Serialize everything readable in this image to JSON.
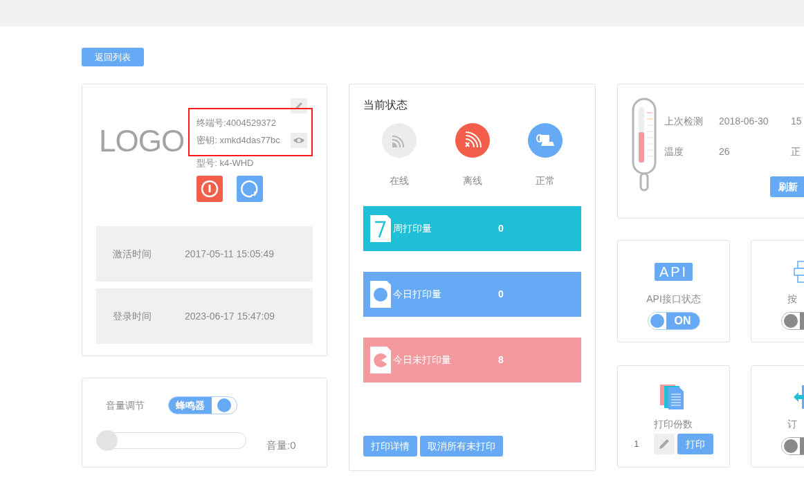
{
  "back_button": "返回列表",
  "device": {
    "logo": "LOGO",
    "terminal": "终端号:4004529372",
    "secret": "密钥: xmkd4das77bc",
    "model": "型号: k4-WHD",
    "times": [
      {
        "label": "激活时间",
        "value": "2017-05-11 15:05:49"
      },
      {
        "label": "登录时间",
        "value": "2023-06-17 15:47:09"
      }
    ]
  },
  "volume": {
    "label": "音量调节",
    "buzzer": {
      "label": "蜂鸣器",
      "on": true
    },
    "slider": {
      "level": 0
    },
    "reading": "音量:0"
  },
  "status": {
    "title": "当前状态",
    "indicators": [
      {
        "kind": "wifi",
        "label": "在线",
        "active": false
      },
      {
        "kind": "wifi-off",
        "label": "离线",
        "active": true
      },
      {
        "kind": "paper",
        "label": "正常",
        "active": true
      }
    ],
    "stats": [
      {
        "kind": "week",
        "label": "周打印量",
        "value": "0",
        "color": "#1fc0d7"
      },
      {
        "kind": "today",
        "label": "今日打印量",
        "value": "0",
        "color": "#66aaf6"
      },
      {
        "kind": "pending",
        "label": "今日未打印量",
        "value": "8",
        "color": "#f4999e"
      }
    ],
    "buttons": [
      "打印详情",
      "取消所有未打印"
    ]
  },
  "sensor": {
    "thermometer": {
      "level": 0.55
    },
    "rows": [
      {
        "label": "上次检测",
        "value": "2018-06-30",
        "column_3": "15"
      },
      {
        "label": "温度",
        "value": "26",
        "column_3": "正"
      }
    ],
    "refresh_button": "刷新"
  },
  "tiles": [
    {
      "kind": "api",
      "badge": "API",
      "label": "API接口状态",
      "toggle": {
        "on": true,
        "text": "ON"
      }
    },
    {
      "kind": "keys",
      "label": "按",
      "toggle": {
        "on": false
      }
    },
    {
      "kind": "copies",
      "label": "打印份数",
      "copies": "1",
      "print_button": "打印"
    },
    {
      "kind": "orders",
      "label": "订",
      "toggle": {
        "on": false
      }
    }
  ]
}
